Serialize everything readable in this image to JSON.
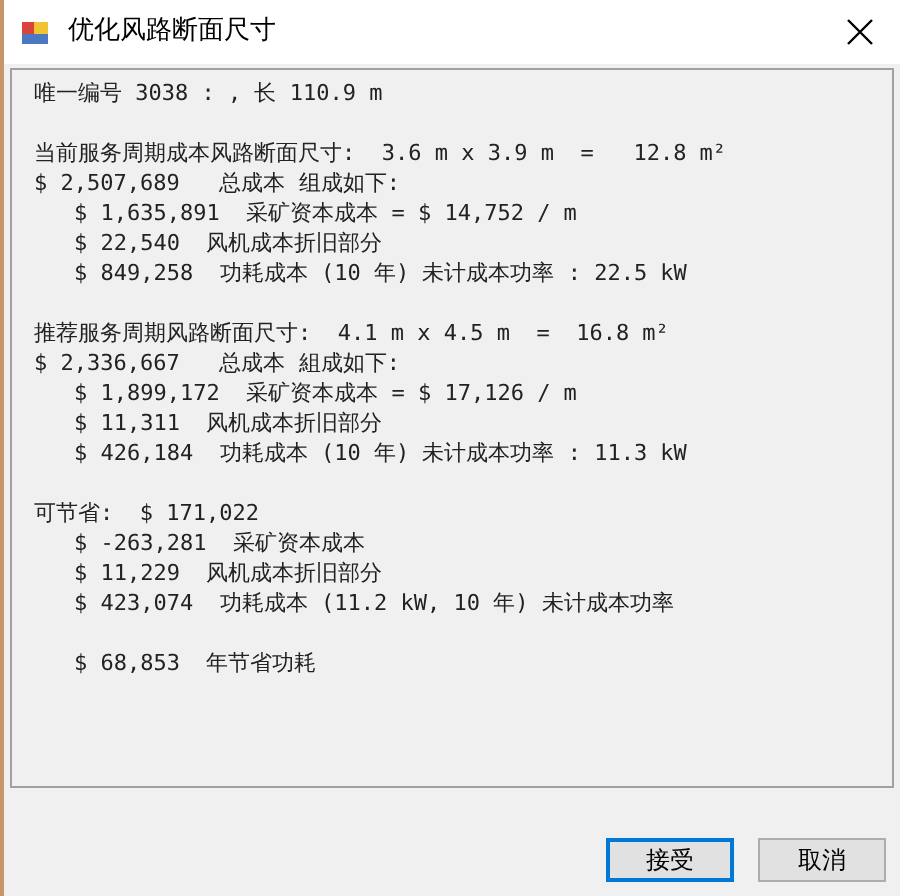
{
  "window": {
    "title": "优化风路断面尺寸"
  },
  "report": {
    "sections": [
      {
        "lines": [
          {
            "text": "唯一编号 3038 : , 长 110.9 m",
            "indented": false
          }
        ]
      },
      {
        "lines": [
          {
            "text": "当前服务周期成本风路断面尺寸:  3.6 m x 3.9 m  =   12.8 m²",
            "indented": false
          },
          {
            "text": "$ 2,507,689   总成本 组成如下:",
            "indented": false
          },
          {
            "text": "$ 1,635,891  采矿资本成本 = $ 14,752 / m",
            "indented": true
          },
          {
            "text": "$ 22,540  风机成本折旧部分",
            "indented": true
          },
          {
            "text": "$ 849,258  功耗成本 (10 年) 未计成本功率 : 22.5 kW",
            "indented": true
          }
        ]
      },
      {
        "lines": [
          {
            "text": "推荐服务周期风路断面尺寸:  4.1 m x 4.5 m  =  16.8 m²",
            "indented": false
          },
          {
            "text": "$ 2,336,667   总成本 組成如下:",
            "indented": false
          },
          {
            "text": "$ 1,899,172  采矿资本成本 = $ 17,126 / m",
            "indented": true
          },
          {
            "text": "$ 11,311  风机成本折旧部分",
            "indented": true
          },
          {
            "text": "$ 426,184  功耗成本 (10 年) 未计成本功率 : 11.3 kW",
            "indented": true
          }
        ]
      },
      {
        "lines": [
          {
            "text": "可节省:  $ 171,022",
            "indented": false
          },
          {
            "text": "$ -263,281  采矿资本成本",
            "indented": true
          },
          {
            "text": "$ 11,229  风机成本折旧部分",
            "indented": true
          },
          {
            "text": "$ 423,074  功耗成本 (11.2 kW, 10 年) 未计成本功率",
            "indented": true
          }
        ]
      },
      {
        "lines": [
          {
            "text": "$ 68,853  年节省功耗",
            "indented": true
          }
        ]
      }
    ]
  },
  "buttons": [
    {
      "label": "接受",
      "focused": true
    },
    {
      "label": "取消",
      "focused": false
    }
  ]
}
